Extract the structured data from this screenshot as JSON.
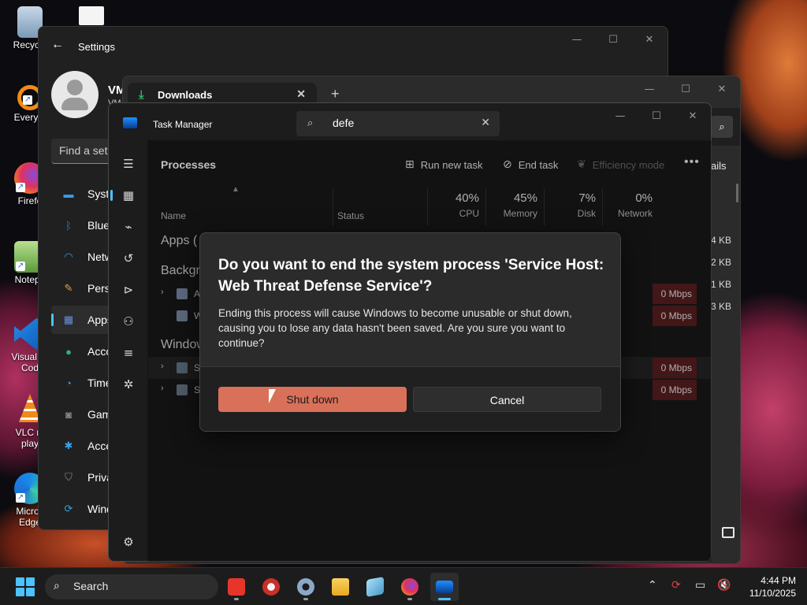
{
  "desktop": {
    "icons": [
      {
        "label": "Recycle",
        "icon": "recycle-bin-icon"
      },
      {
        "label": "Everyth",
        "icon": "everything-search-icon"
      },
      {
        "label": "Firefo",
        "icon": "firefox-icon"
      },
      {
        "label": "Notepa",
        "icon": "notepad-icon"
      },
      {
        "label": "Visual St\nCod",
        "icon": "vscode-icon"
      },
      {
        "label": "VLC m\nplay",
        "icon": "vlc-icon"
      },
      {
        "label": "Micros\nEdge",
        "icon": "edge-icon"
      }
    ]
  },
  "settings": {
    "title": "Settings",
    "user_name": "VM",
    "user_sub": "VM",
    "find_placeholder": "Find a sett",
    "nav": [
      {
        "label": "Syste",
        "icon": "monitor-icon",
        "color": "#3a9be0"
      },
      {
        "label": "Bluet",
        "icon": "bluetooth-icon",
        "color": "#2a7bd8"
      },
      {
        "label": "Netw",
        "icon": "wifi-icon",
        "color": "#3aa0e8"
      },
      {
        "label": "Perso",
        "icon": "paintbrush-icon",
        "color": "#e0a050"
      },
      {
        "label": "Apps",
        "icon": "apps-icon",
        "color": "#6a8ed8",
        "active": true
      },
      {
        "label": "Acco",
        "icon": "account-icon",
        "color": "#30b080"
      },
      {
        "label": "Time",
        "icon": "clock-globe-icon",
        "color": "#3a9be0"
      },
      {
        "label": "Gam",
        "icon": "gamepad-icon",
        "color": "#8a8a8a"
      },
      {
        "label": "Acce",
        "icon": "accessibility-icon",
        "color": "#3aa0e8"
      },
      {
        "label": "Priva",
        "icon": "shield-icon",
        "color": "#8a8a8a"
      },
      {
        "label": "Wind",
        "icon": "windows-update-icon",
        "color": "#3a9be0"
      }
    ]
  },
  "downloads": {
    "tab_label": "Downloads",
    "toolbar_right": "ails"
  },
  "taskmanager": {
    "title": "Task Manager",
    "search_value": "defe",
    "page_title": "Processes",
    "actions": {
      "run_new_task": "Run new task",
      "end_task": "End task",
      "efficiency_mode": "Efficiency mode"
    },
    "columns": {
      "name": "Name",
      "status": "Status",
      "cpu": {
        "pct": "40%",
        "label": "CPU"
      },
      "memory": {
        "pct": "45%",
        "label": "Memory"
      },
      "disk": {
        "pct": "7%",
        "label": "Disk"
      },
      "network": {
        "pct": "0%",
        "label": "Network"
      }
    },
    "groups": {
      "apps": "Apps (",
      "background": "Backgr",
      "windows": "Window"
    },
    "rows": [
      {
        "name": "A",
        "network": "0 Mbps",
        "mem_suffix": "1 KB"
      },
      {
        "name": "W",
        "network": "0 Mbps",
        "mem_suffix": "3 KB"
      },
      {
        "name": "S",
        "network": "0 Mbps"
      },
      {
        "name": "S",
        "network": "0 Mbps"
      }
    ],
    "right_edge_values": [
      "4 KB",
      "2 KB"
    ]
  },
  "dialog": {
    "title": "Do you want to end the system process 'Service Host: Web Threat Defense Service'?",
    "body": "Ending this process will cause Windows to become unusable or shut down, causing you to lose any data hasn't been saved. Are you sure you want to continue?",
    "primary": "Shut down",
    "secondary": "Cancel"
  },
  "taskbar": {
    "search_label": "Search",
    "time": "4:44 PM",
    "date": "11/10/2025"
  }
}
